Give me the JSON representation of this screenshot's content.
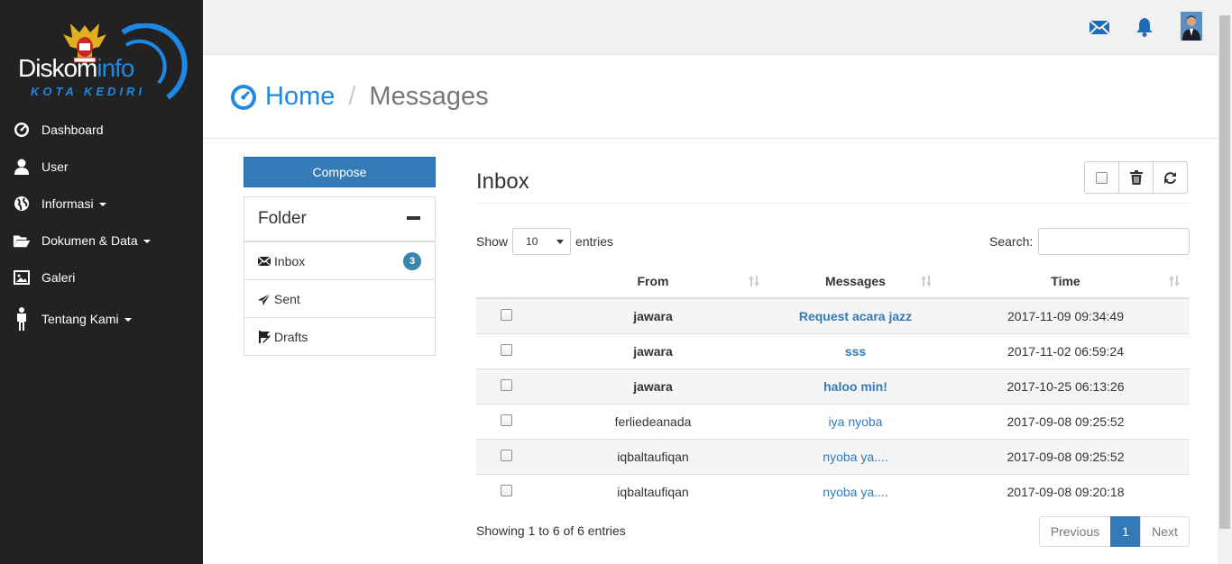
{
  "brand": {
    "name_part1": "Diskom",
    "name_part2": "info",
    "subtitle": "KOTA KEDIRI"
  },
  "sidebar": {
    "items": [
      {
        "label": "Dashboard",
        "icon": "dashboard-icon",
        "dropdown": false
      },
      {
        "label": "User",
        "icon": "user-icon",
        "dropdown": false
      },
      {
        "label": "Informasi",
        "icon": "globe-icon",
        "dropdown": true
      },
      {
        "label": "Dokumen & Data",
        "icon": "folder-open-icon",
        "dropdown": true
      },
      {
        "label": "Galeri",
        "icon": "picture-icon",
        "dropdown": false
      },
      {
        "label": "Tentang Kami",
        "icon": "person-icon",
        "dropdown": true
      }
    ]
  },
  "topbar": {
    "icons": [
      "envelope-icon",
      "bell-icon",
      "user-avatar"
    ]
  },
  "breadcrumb": {
    "home": "Home",
    "separator": "/",
    "current": "Messages"
  },
  "compose_label": "Compose",
  "folder": {
    "title": "Folder",
    "items": [
      {
        "label": "Inbox",
        "icon": "envelope-icon",
        "badge": "3"
      },
      {
        "label": "Sent",
        "icon": "send-icon",
        "badge": ""
      },
      {
        "label": "Drafts",
        "icon": "drafts-icon",
        "badge": ""
      }
    ]
  },
  "inbox": {
    "title": "Inbox",
    "show_label": "Show",
    "entries_value": "10",
    "entries_label": "entries",
    "search_label": "Search:",
    "search_value": "",
    "columns": [
      "From",
      "Messages",
      "Time"
    ],
    "rows": [
      {
        "from": "jawara",
        "message": "Request acara jazz",
        "time": "2017-11-09 09:34:49",
        "unread": true
      },
      {
        "from": "jawara",
        "message": "sss",
        "time": "2017-11-02 06:59:24",
        "unread": true
      },
      {
        "from": "jawara",
        "message": "haloo min!",
        "time": "2017-10-25 06:13:26",
        "unread": true
      },
      {
        "from": "ferliedeanada",
        "message": "iya nyoba",
        "time": "2017-09-08 09:25:52",
        "unread": false
      },
      {
        "from": "iqbaltaufiqan",
        "message": "nyoba ya....",
        "time": "2017-09-08 09:25:52",
        "unread": false
      },
      {
        "from": "iqbaltaufiqan",
        "message": "nyoba ya....",
        "time": "2017-09-08 09:20:18",
        "unread": false
      }
    ],
    "info": "Showing 1 to 6 of 6 entries",
    "pagination": {
      "previous": "Previous",
      "current": "1",
      "next": "Next"
    }
  },
  "colors": {
    "sidebar_bg": "#222222",
    "accent": "#1e88e5",
    "primary": "#337ab7",
    "badge": "#3a87ad"
  }
}
